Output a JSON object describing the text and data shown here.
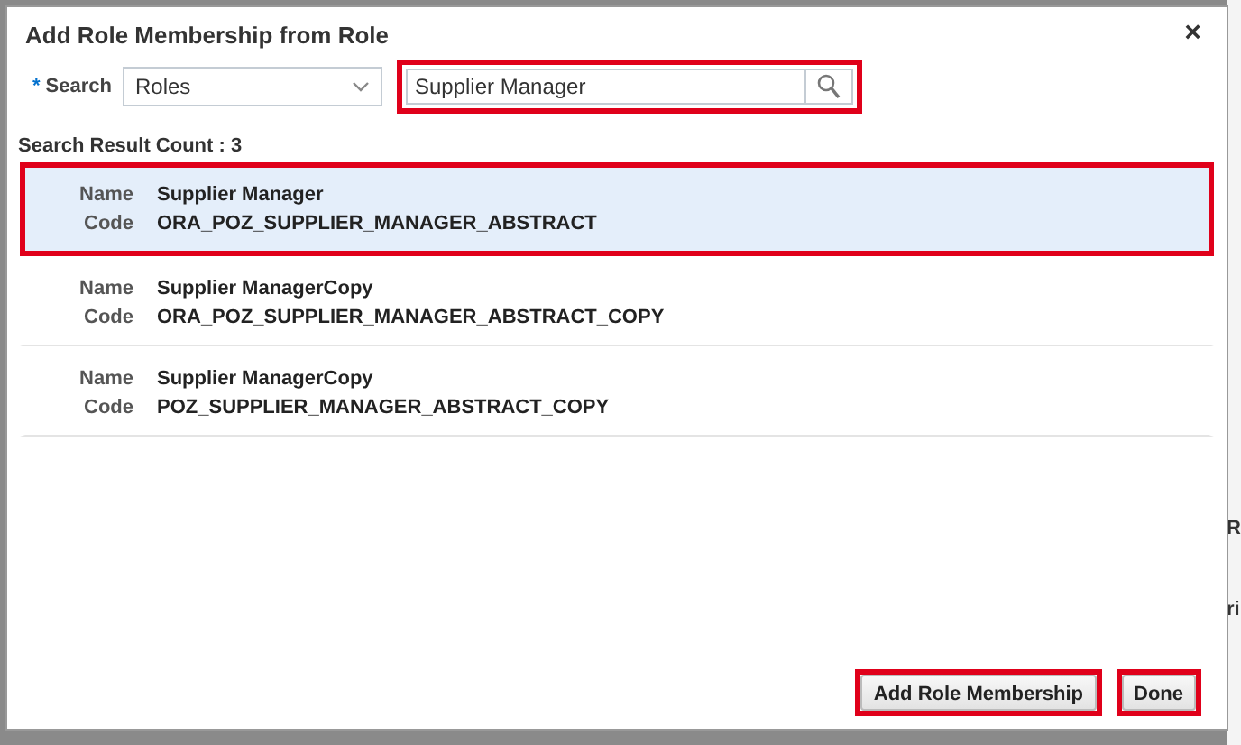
{
  "background": {
    "fragments": [
      "R",
      "ri"
    ]
  },
  "dialog": {
    "title": "Add Role Membership from Role",
    "close": "×"
  },
  "search": {
    "label": "Search",
    "required": true,
    "required_mark": "*",
    "type_value": "Roles",
    "query": "Supplier Manager",
    "highlighted": true
  },
  "result_count": "Search Result Count : 3",
  "results": [
    {
      "name_label": "Name",
      "name": "Supplier Manager",
      "code_label": "Code",
      "code": "ORA_POZ_SUPPLIER_MANAGER_ABSTRACT",
      "selected": true,
      "highlighted": true
    },
    {
      "name_label": "Name",
      "name": "Supplier ManagerCopy",
      "code_label": "Code",
      "code": "ORA_POZ_SUPPLIER_MANAGER_ABSTRACT_COPY",
      "selected": false,
      "highlighted": false
    },
    {
      "name_label": "Name",
      "name": "Supplier ManagerCopy",
      "code_label": "Code",
      "code": "POZ_SUPPLIER_MANAGER_ABSTRACT_COPY",
      "selected": false,
      "highlighted": false
    }
  ],
  "buttons": [
    {
      "label": "Add Role Membership",
      "highlighted": true
    },
    {
      "label": "Done",
      "highlighted": true
    }
  ]
}
